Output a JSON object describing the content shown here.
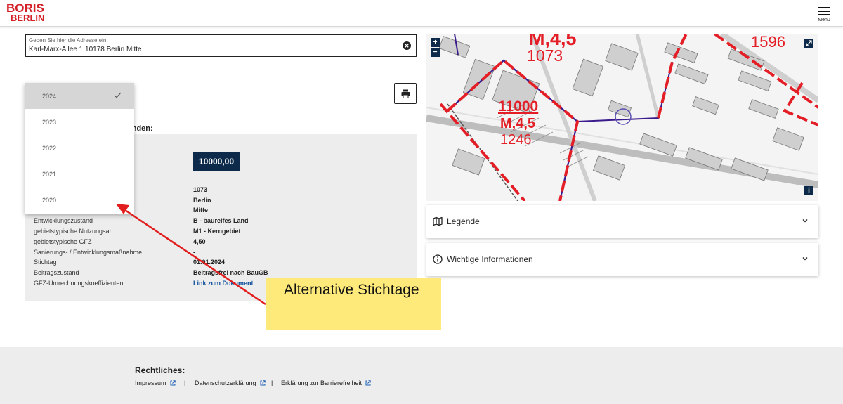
{
  "header": {
    "logo_top": "BORIS",
    "logo_bottom": "BERLIN",
    "menu_label": "Menü"
  },
  "search": {
    "label": "Geben Sie hier die Adresse ein",
    "value": "Karl-Marx-Allee 1 10178 Berlin Mitte"
  },
  "found_heading": "unden:",
  "bodenrichtwert": "10000,00",
  "info_rows": [
    {
      "label": "",
      "value": "1073"
    },
    {
      "label": "",
      "value": "Berlin"
    },
    {
      "label": "",
      "value": "Mitte"
    },
    {
      "label": "Entwicklungszustand",
      "value": "B - baureifes Land"
    },
    {
      "label": "gebietstypische Nutzungsart",
      "value": "M1 - Kerngebiet"
    },
    {
      "label": "gebietstypische GFZ",
      "value": "4,50"
    },
    {
      "label": "Sanierungs- / Entwicklungsmaßnahme",
      "value": "-"
    },
    {
      "label": "Stichtag",
      "value": "01.01.2024"
    },
    {
      "label": "Beitragszustand",
      "value": "Beitragsfrei nach BauGB"
    },
    {
      "label": "GFZ-Umrechnungskoeffizienten",
      "value": "Link zum Dokument"
    }
  ],
  "year_dropdown": {
    "options": [
      "2024",
      "2023",
      "2022",
      "2021",
      "2020"
    ],
    "selected": "2024"
  },
  "map": {
    "zoom_in": "+",
    "zoom_out": "−",
    "info": "i",
    "labels": {
      "top_left_1": "M,4,5",
      "top_left_2": "1073",
      "top_right": "1596",
      "center_1": "11000",
      "center_2": "M,4,5",
      "center_3": "1246"
    },
    "colors": {
      "zone_line": "#e41e26",
      "boundary": "#3a1a8c"
    }
  },
  "accordions": {
    "legend": "Legende",
    "info": "Wichtige Informationen"
  },
  "annotation": {
    "text": "Alternative Stichtage",
    "color": "#fdea7a",
    "arrow_color": "#e11d1d"
  },
  "footer": {
    "title": "Rechtliches:",
    "links": [
      "Impressum",
      "Datenschutzerklärung",
      "Erklärung zur Barrierefreiheit"
    ],
    "separator": "|"
  }
}
